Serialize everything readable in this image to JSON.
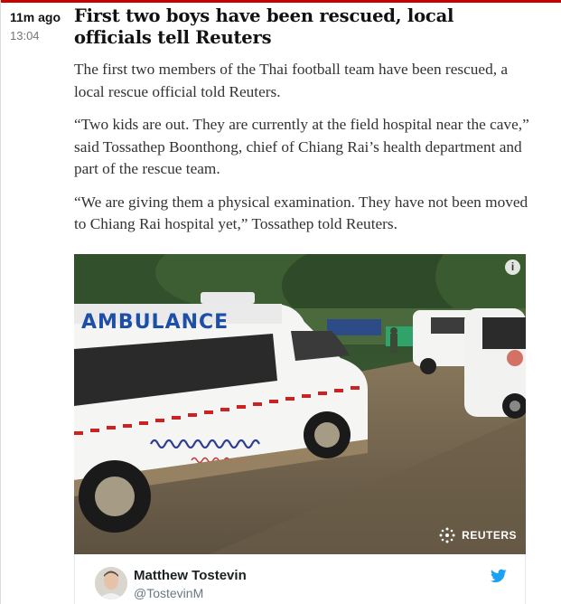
{
  "entry": {
    "time_ago": "11m ago",
    "time": "13:04",
    "headline": "First two boys have been rescued, local officials tell Reuters",
    "paragraphs": [
      "The first two members of the Thai football team have been rescued, a local rescue official told Reuters.",
      "“Two kids are out. They are currently at the field hospital near the cave,” said Tossathep Boonthong, chief of Chiang Rai’s health department and part of the rescue team.",
      "“We are giving them a physical examination. They have not been moved to Chiang Rai hospital yet,” Tossathep told Reuters."
    ]
  },
  "photo": {
    "info_icon": "info-icon",
    "ambulance_text": "AMBULANCE",
    "watermark": "REUTERS"
  },
  "tweet": {
    "name": "Matthew Tostevin",
    "handle": "@TostevinM",
    "icon": "twitter-bird-icon"
  },
  "colors": {
    "accent": "#c70000",
    "twitter": "#1da1f2",
    "ambulance_blue": "#1e4fa8"
  }
}
